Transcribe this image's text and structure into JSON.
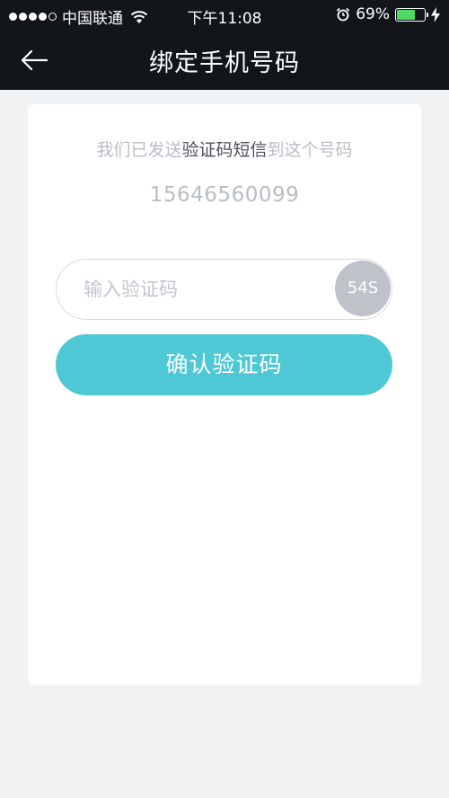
{
  "status_bar": {
    "carrier": "中国联通",
    "time": "下午11:08",
    "battery_percent": "69%",
    "battery_level": 0.69,
    "battery_color": "#4cd964",
    "icons": [
      "signal-dots-icon",
      "wifi-icon",
      "alarm-icon",
      "battery-icon",
      "charging-bolt-icon"
    ]
  },
  "nav": {
    "title": "绑定手机号码",
    "back_icon": "arrow-left-icon"
  },
  "card": {
    "hint_prefix": "我们已发送",
    "hint_emphasis": "验证码短信",
    "hint_suffix": "到这个号码",
    "phone_number": "15646560099",
    "code_input": {
      "value": "",
      "placeholder": "输入验证码"
    },
    "countdown_label": "54S",
    "confirm_label": "确认验证码"
  },
  "colors": {
    "header_bg": "#12151a",
    "page_bg": "#f1f2f4",
    "accent": "#4fc8d6",
    "countdown_bg": "#bfc3c9"
  }
}
